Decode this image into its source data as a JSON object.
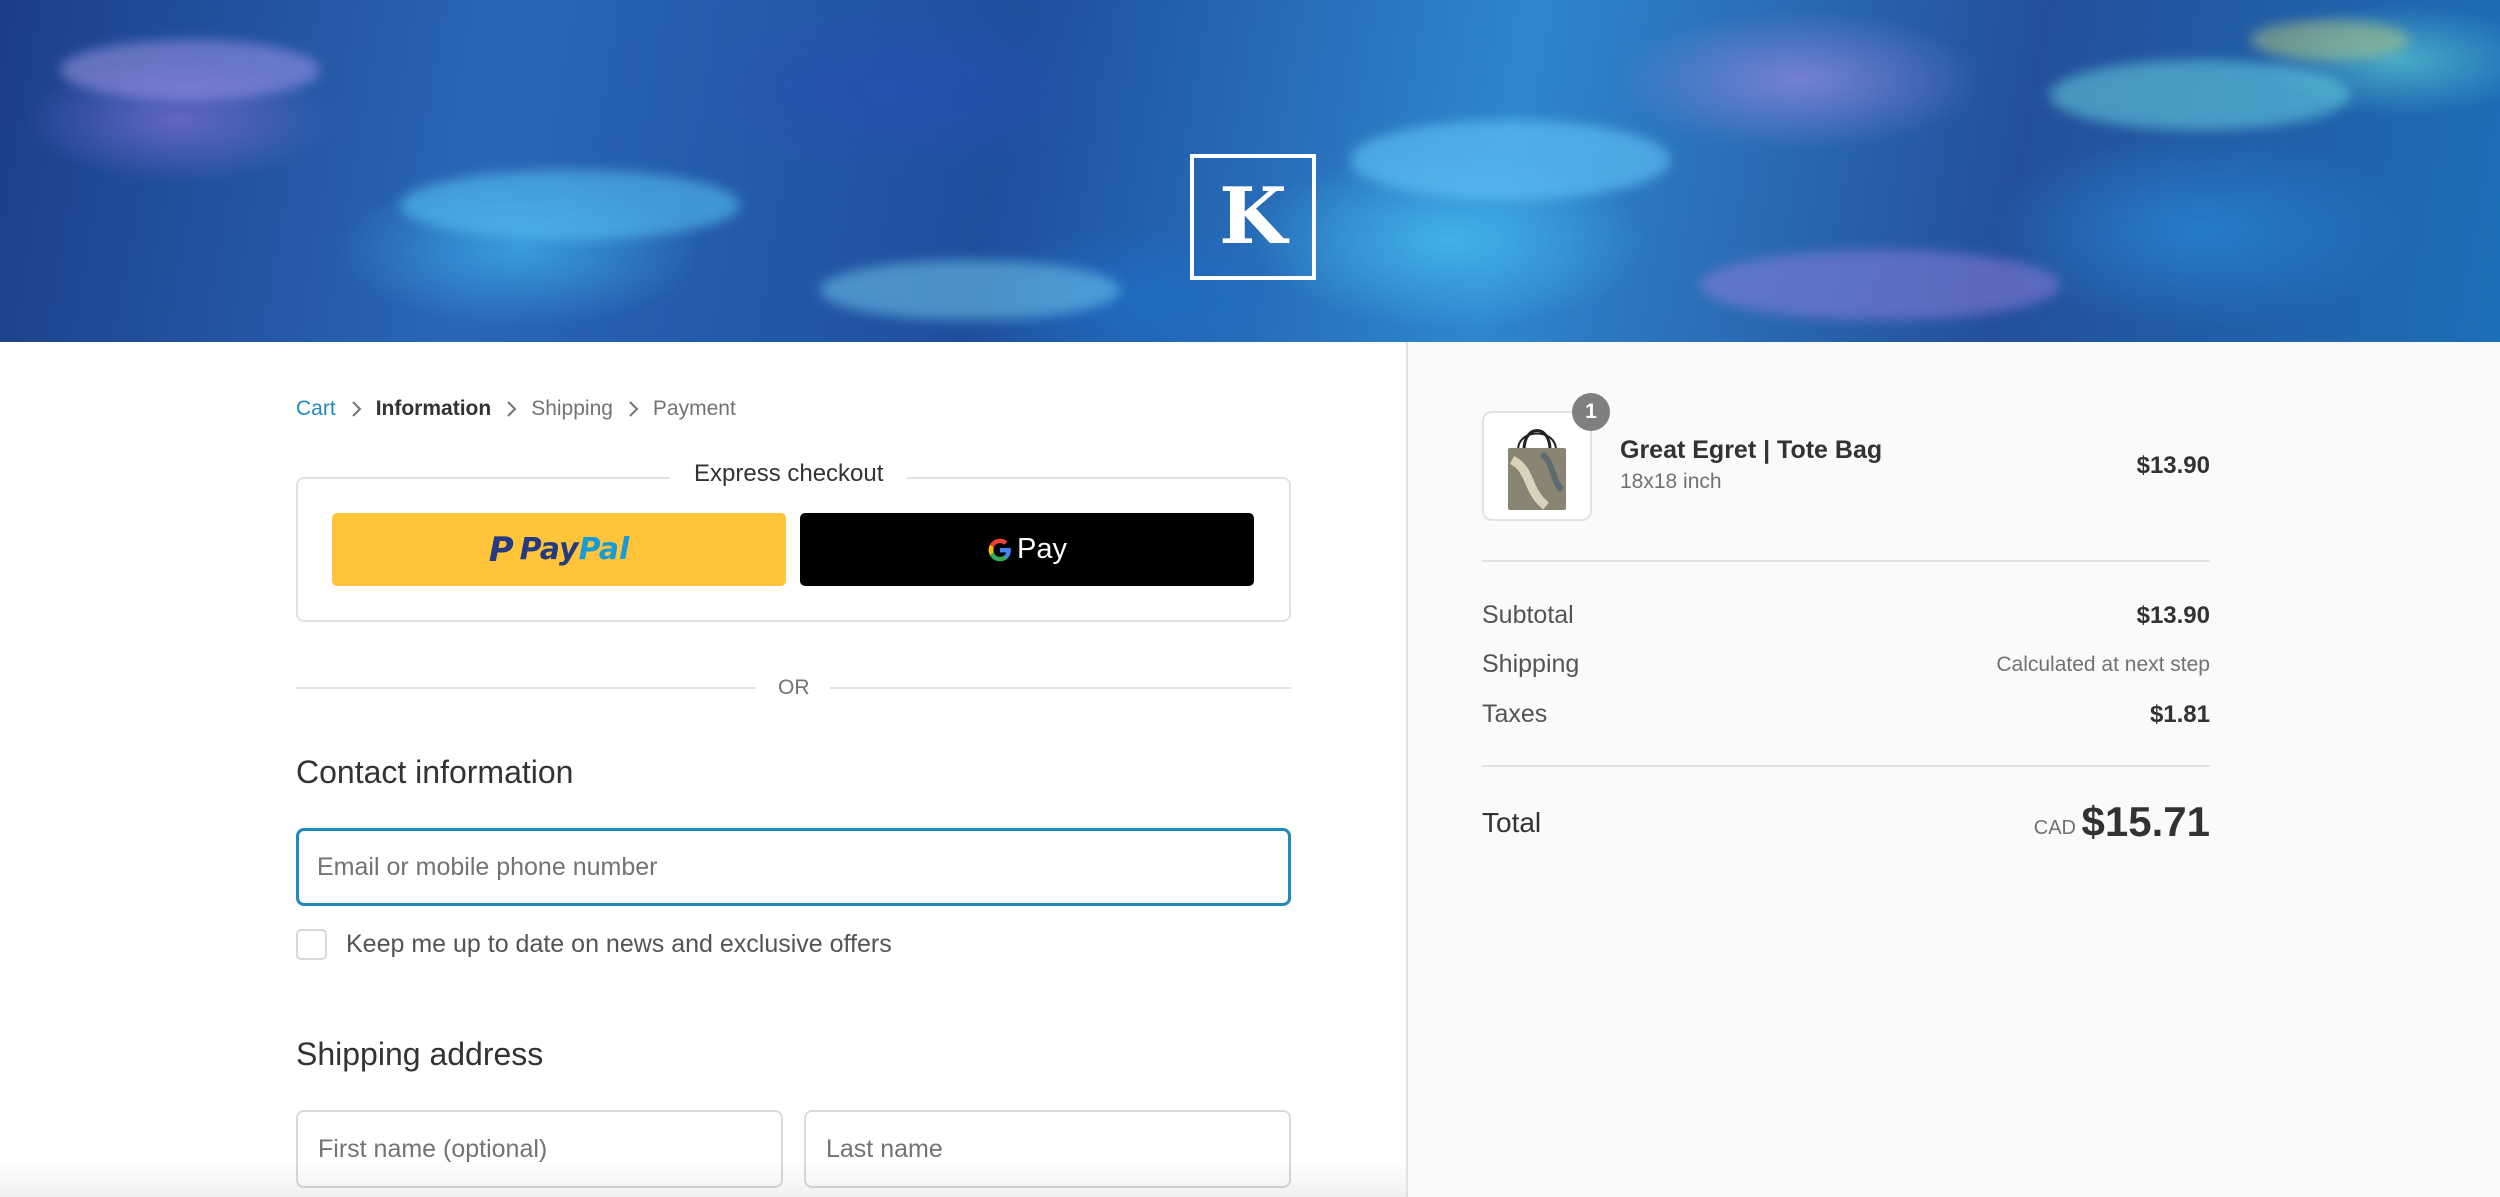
{
  "header": {
    "logo_letter": "K"
  },
  "breadcrumb": {
    "items": [
      {
        "label": "Cart",
        "state": "link"
      },
      {
        "label": "Information",
        "state": "current"
      },
      {
        "label": "Shipping",
        "state": "upcoming"
      },
      {
        "label": "Payment",
        "state": "upcoming"
      }
    ]
  },
  "express_checkout": {
    "title": "Express checkout",
    "paypal": {
      "prefix_glyph": "P",
      "word_pay": "Pay",
      "word_pal": "Pal"
    },
    "gpay": {
      "label": "Pay"
    },
    "or_text": "OR"
  },
  "contact": {
    "title": "Contact information",
    "email_placeholder": "Email or mobile phone number",
    "newsletter_label": "Keep me up to date on news and exclusive offers"
  },
  "shipping_address": {
    "title": "Shipping address",
    "first_name_placeholder": "First name (optional)",
    "last_name_placeholder": "Last name"
  },
  "order_summary": {
    "product": {
      "name": "Great Egret | Tote Bag",
      "variant": "18x18 inch",
      "price": "$13.90",
      "quantity": "1"
    },
    "subtotal_label": "Subtotal",
    "subtotal_value": "$13.90",
    "shipping_label": "Shipping",
    "shipping_value": "Calculated at next step",
    "taxes_label": "Taxes",
    "taxes_value": "$1.81",
    "total_label": "Total",
    "total_currency": "CAD",
    "total_value": "$15.71"
  },
  "colors": {
    "accent_link": "#1f8ac0",
    "paypal_yellow": "#ffc439",
    "gpay_black": "#000000",
    "badge_gray": "#7f7f7f"
  },
  "icons": {
    "breadcrumb_separator": "chevron-right-icon",
    "gpay_logo": "google-g-icon",
    "paypal_logo": "paypal-icon"
  }
}
